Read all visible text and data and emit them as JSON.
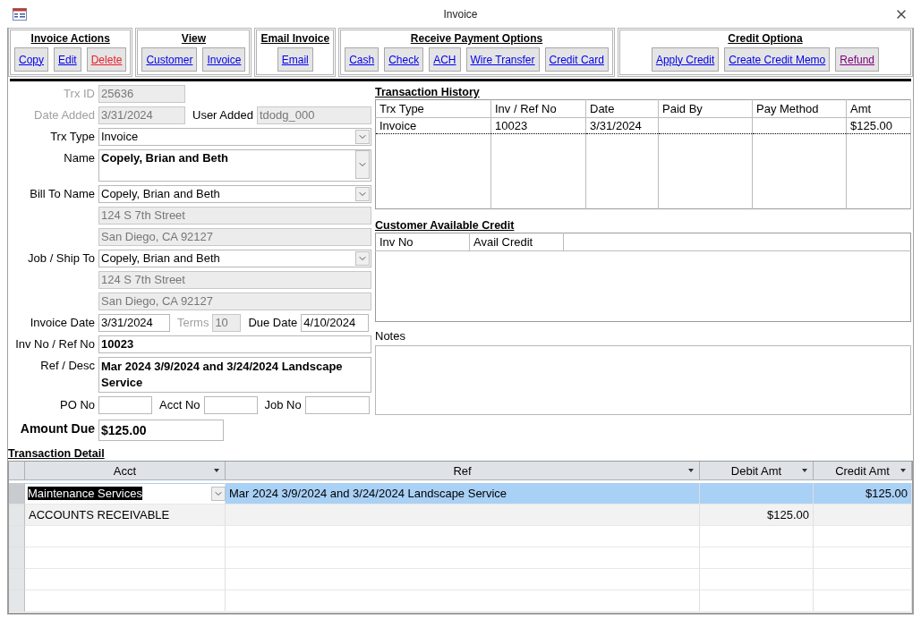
{
  "window": {
    "title": "Invoice"
  },
  "toolbar": [
    {
      "title": "Invoice Actions",
      "buttons": [
        {
          "label": "Copy",
          "color": "#0000ee"
        },
        {
          "label": "Edit",
          "color": "#0000ee"
        },
        {
          "label": "Delete",
          "color": "#e8202a"
        }
      ]
    },
    {
      "title": "View",
      "buttons": [
        {
          "label": "Customer",
          "color": "#0000ee"
        },
        {
          "label": "Invoice",
          "color": "#0000ee"
        }
      ]
    },
    {
      "title": "Email Invoice",
      "buttons": [
        {
          "label": "Email",
          "color": "#0000ee"
        }
      ]
    },
    {
      "title": "Receive Payment Options",
      "buttons": [
        {
          "label": "Cash",
          "color": "#0000ee"
        },
        {
          "label": "Check",
          "color": "#0000ee"
        },
        {
          "label": "ACH",
          "color": "#0000ee"
        },
        {
          "label": "Wire Transfer",
          "color": "#0000ee"
        },
        {
          "label": "Credit Card",
          "color": "#0000ee"
        }
      ]
    },
    {
      "title": "Credit Optiona",
      "buttons": [
        {
          "label": "Apply Credit",
          "color": "#0000ee"
        },
        {
          "label": "Create Credit Memo",
          "color": "#0000ee"
        },
        {
          "label": "Refund",
          "color": "#800080"
        }
      ]
    }
  ],
  "form": [
    {
      "fields": [
        {
          "label": "Trx ID",
          "value": "25636",
          "kind": "text",
          "locked": true,
          "disabled": true
        }
      ]
    },
    {
      "fields": [
        {
          "label": "Date Added",
          "value": "3/31/2024",
          "kind": "text",
          "locked": true,
          "disabled": true
        },
        {
          "label": "User Added",
          "value": "tdodg_000",
          "kind": "text",
          "locked": true,
          "disabled": false
        }
      ]
    },
    {
      "fields": [
        {
          "label": "Trx Type",
          "value": "Invoice",
          "kind": "combo",
          "locked": false,
          "disabled": false
        }
      ]
    },
    {
      "fields": [
        {
          "label": "Name",
          "value": "Copely, Brian and Beth",
          "kind": "tallcombo",
          "locked": false,
          "disabled": false,
          "bold": true
        }
      ]
    },
    {
      "fields": [
        {
          "label": "Bill To Name",
          "value": "Copely, Brian and Beth",
          "kind": "combo",
          "locked": false,
          "disabled": false
        }
      ]
    },
    {
      "fields": [
        {
          "value": "124 S 7th Street",
          "kind": "text",
          "locked": true
        }
      ]
    },
    {
      "fields": [
        {
          "value": "San Diego, CA  92127",
          "kind": "text",
          "locked": true
        }
      ]
    },
    {
      "fields": [
        {
          "label": "Job / Ship To",
          "value": "Copely, Brian and Beth",
          "kind": "combo",
          "locked": false,
          "disabled": false
        }
      ]
    },
    {
      "fields": [
        {
          "value": "124 S 7th Street",
          "kind": "text",
          "locked": true
        }
      ]
    },
    {
      "fields": [
        {
          "value": "San Diego, CA  92127",
          "kind": "text",
          "locked": true
        }
      ]
    },
    {
      "fields": [
        {
          "label": "Invoice Date",
          "value": "3/31/2024",
          "kind": "text",
          "locked": false,
          "disabled": false
        },
        {
          "label": "Terms",
          "value": "10",
          "kind": "text",
          "locked": true,
          "disabled": true
        },
        {
          "label": "Due Date",
          "value": "4/10/2024",
          "kind": "text",
          "locked": false,
          "disabled": false
        }
      ]
    },
    {
      "fields": [
        {
          "label": "Inv No / Ref No",
          "value": "10023",
          "kind": "text",
          "locked": false,
          "disabled": false,
          "bold": true
        }
      ]
    },
    {
      "fields": [
        {
          "label": "Ref / Desc",
          "value": "Mar 2024 3/9/2024 and 3/24/2024 Landscape Service",
          "kind": "area",
          "locked": false,
          "disabled": false,
          "bold": true
        }
      ]
    },
    {
      "fields": [
        {
          "label": "PO No",
          "kind": "text",
          "locked": false,
          "disabled": false
        },
        {
          "label": "Acct No",
          "kind": "text",
          "locked": false,
          "disabled": false
        },
        {
          "label": "Job No",
          "kind": "text",
          "locked": false,
          "disabled": false
        }
      ]
    },
    {
      "fields": [
        {
          "label": "Amount Due",
          "value": "$125.00",
          "kind": "big",
          "locked": false,
          "disabled": false,
          "bold": true
        }
      ]
    }
  ],
  "transaction_history": {
    "title": "Transaction History",
    "columns": [
      "Trx Type",
      "Inv / Ref No",
      "Date",
      "Paid By",
      "Pay Method",
      "Amt"
    ],
    "rows": [
      {
        "cells": [
          "Invoice",
          "10023",
          "3/31/2024",
          "",
          "",
          "$125.00"
        ],
        "selected": true
      }
    ]
  },
  "customer_available_credit": {
    "title": "Customer Available Credit",
    "columns": [
      "Inv No",
      "Avail Credit"
    ]
  },
  "notes": {
    "label": "Notes"
  },
  "transaction_detail": {
    "title": "Transaction Detail",
    "columns": [
      "Acct",
      "Ref",
      "Debit Amt",
      "Credit Amt"
    ],
    "rows": [
      {
        "acct": "Maintenance Services",
        "ref": "Mar 2024 3/9/2024 and 3/24/2024 Landscape Service",
        "debit": "",
        "credit": "$125.00",
        "selected": true
      },
      {
        "acct": "ACCOUNTS RECEIVABLE",
        "ref": "",
        "debit": "$125.00",
        "credit": "",
        "selected": false
      }
    ]
  }
}
